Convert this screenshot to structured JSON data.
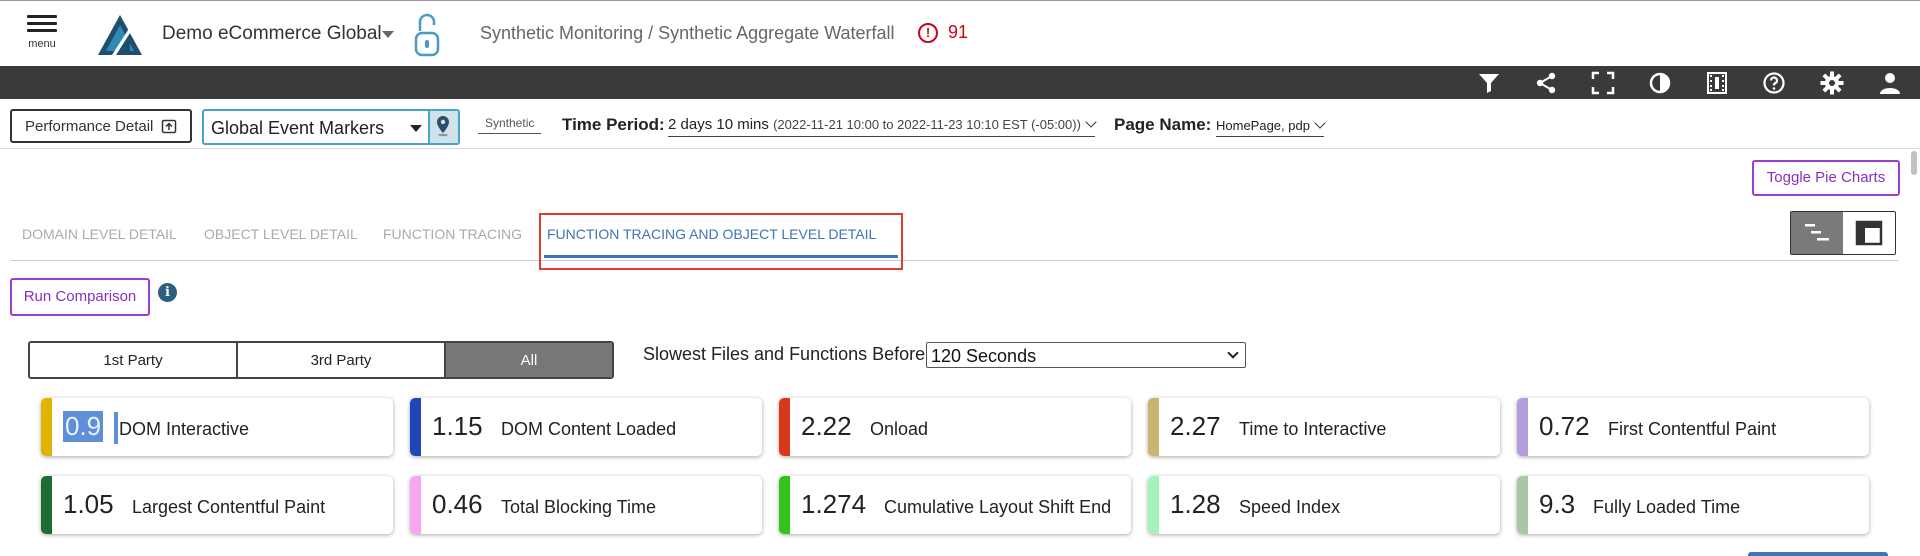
{
  "header": {
    "menu_label": "menu",
    "app_name": "Demo eCommerce Global",
    "breadcrumb": "Synthetic Monitoring / Synthetic Aggregate Waterfall",
    "alert_count": "91",
    "alert_glyph": "!"
  },
  "toolbar": {
    "icons": [
      "filter-icon",
      "share-icon",
      "fullscreen-icon",
      "contrast-icon",
      "film-icon",
      "help-icon",
      "gear-icon",
      "user-icon"
    ]
  },
  "filters": {
    "performance_detail_label": "Performance Detail",
    "event_markers_value": "Global Event Markers",
    "synthetic_tag": "Synthetic",
    "time_period_label": "Time Period:",
    "time_period_value": "2 days 10 mins",
    "time_period_range": "(2022-11-21 10:00 to 2022-11-23 10:10 EST (-05:00))",
    "page_name_label": "Page Name:",
    "page_name_value": "HomePage, pdp"
  },
  "toggle_pie_label": "Toggle Pie Charts",
  "tabs": [
    {
      "label": "DOMAIN LEVEL DETAIL",
      "active": false
    },
    {
      "label": "OBJECT LEVEL DETAIL",
      "active": false
    },
    {
      "label": "FUNCTION TRACING",
      "active": false
    },
    {
      "label": "FUNCTION TRACING AND OBJECT LEVEL DETAIL",
      "active": true
    }
  ],
  "run_comparison_label": "Run Comparison",
  "info_glyph": "i",
  "party": {
    "options": [
      "1st Party",
      "3rd Party",
      "All"
    ],
    "selected": "All"
  },
  "slowest": {
    "label": "Slowest Files and Functions Before:",
    "value": "120 Seconds"
  },
  "metrics": [
    {
      "value": "0.9",
      "label": "DOM Interactive",
      "color": "#e0b400"
    },
    {
      "value": "1.15",
      "label": "DOM Content Loaded",
      "color": "#1f45b8"
    },
    {
      "value": "2.22",
      "label": "Onload",
      "color": "#d63a1a"
    },
    {
      "value": "2.27",
      "label": "Time to Interactive",
      "color": "#c9b56f"
    },
    {
      "value": "0.72",
      "label": "First Contentful Paint",
      "color": "#b39ddb"
    },
    {
      "value": "1.05",
      "label": "Largest Contentful Paint",
      "color": "#1e6b36"
    },
    {
      "value": "0.46",
      "label": "Total Blocking Time",
      "color": "#f5a8f0"
    },
    {
      "value": "1.274",
      "label": "Cumulative Layout Shift End",
      "color": "#35c21a"
    },
    {
      "value": "1.28",
      "label": "Speed Index",
      "color": "#a6f2bd"
    },
    {
      "value": "9.3",
      "label": "Fully Loaded Time",
      "color": "#a9c7a3"
    }
  ],
  "colors": {
    "accent_purple": "#9c3fd1",
    "tab_active": "#3f74b5",
    "highlight_red": "#e53935",
    "toolbar_bg": "#3a3a3a",
    "logo": "#1d4f6e"
  }
}
